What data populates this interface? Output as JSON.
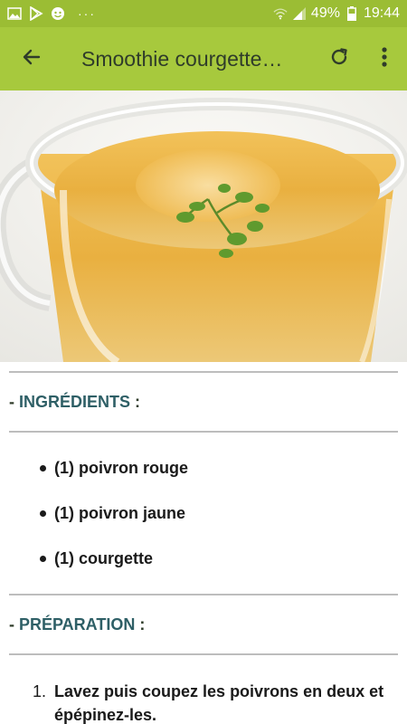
{
  "status_bar": {
    "battery_text": "49%",
    "time": "19:44",
    "left_icons": [
      "image-icon",
      "play-store-icon",
      "face-icon"
    ],
    "more_indicator": "···"
  },
  "app_bar": {
    "title": "Smoothie courgette…",
    "back_icon": "arrow-back-icon",
    "refresh_icon": "refresh-icon",
    "more_icon": "more-vert-icon",
    "color": "#a7c93d",
    "status_color": "#9bbd34"
  },
  "ingredients": {
    "heading_dash": "- ",
    "heading": "INGRÉDIENTS",
    "heading_suffix": " :",
    "items": [
      "(1) poivron rouge",
      "(1) poivron jaune",
      "(1) courgette"
    ]
  },
  "preparation": {
    "heading_dash": "- ",
    "heading": "PRÉPARATION",
    "heading_suffix": " :",
    "steps": [
      {
        "num": "1.",
        "line1": "Lavez puis coupez les poivrons en deux et",
        "line2": "épépinez-les."
      }
    ]
  }
}
